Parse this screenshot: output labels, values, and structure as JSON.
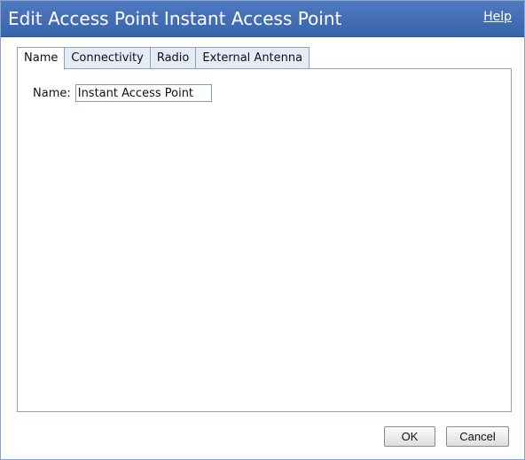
{
  "dialog": {
    "title": "Edit Access Point Instant Access Point",
    "help_label": "Help"
  },
  "tabs": [
    {
      "label": "Name",
      "active": true
    },
    {
      "label": "Connectivity",
      "active": false
    },
    {
      "label": "Radio",
      "active": false
    },
    {
      "label": "External Antenna",
      "active": false
    }
  ],
  "name_tab": {
    "name_label": "Name:",
    "name_value": "Instant Access Point"
  },
  "buttons": {
    "ok_label": "OK",
    "cancel_label": "Cancel"
  },
  "colors": {
    "titlebar": "#3864ac",
    "tab_inactive": "#e6ecf5",
    "border": "#8fa1b8"
  }
}
